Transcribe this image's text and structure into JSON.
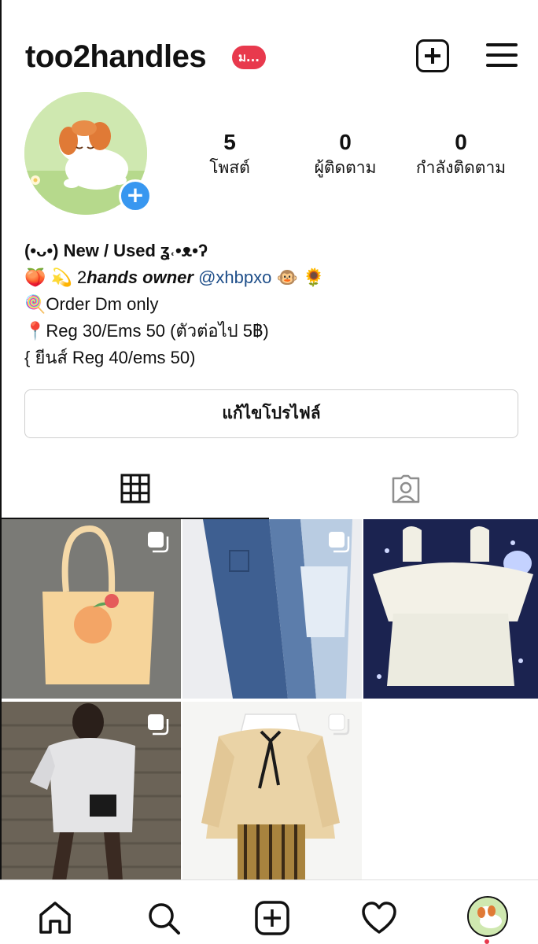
{
  "header": {
    "username": "too2handles",
    "badge": "ม...",
    "create_icon": "plus-square-icon",
    "menu_icon": "hamburger-menu-icon"
  },
  "profile": {
    "avatar_add_symbol": "+"
  },
  "stats": {
    "posts": {
      "count": "5",
      "label": "โพสต์"
    },
    "followers": {
      "count": "0",
      "label": "ผู้ติดตาม"
    },
    "following": {
      "count": "0",
      "label": "กำลังติดตาม"
    }
  },
  "bio": {
    "line1": "(•ᴗ•) New / Used ʓ˓•ᴥ•ʔ",
    "line2_emoji": "🍑 💫",
    "line2_text": "2",
    "line2_italic": "hands owner",
    "line2_mention": "@xhbpxo",
    "line2_end_emoji": "🐵 🌻",
    "line3_emoji": "🍭",
    "line3_text": "Order Dm only",
    "line4_emoji": "📍",
    "line4_text": "Reg 30/Ems 50 (ตัวต่อไป 5฿)",
    "line5_text": "{ ยีนส์ Reg 40/ems 50)"
  },
  "edit_profile_label": "แก้ไขโปรไฟล์",
  "tabs": [
    {
      "name": "grid",
      "icon": "grid-icon",
      "active": true
    },
    {
      "name": "tagged",
      "icon": "tagged-person-icon",
      "active": false
    }
  ],
  "posts": [
    {
      "subject": "peach tote bag",
      "multi": true
    },
    {
      "subject": "two-tone jeans",
      "multi": true
    },
    {
      "subject": "white ruffle top",
      "multi": false
    },
    {
      "subject": "oversized tee outfit",
      "multi": true
    },
    {
      "subject": "cream cardigan with bow",
      "multi": true
    }
  ],
  "bottom_nav": [
    {
      "name": "home",
      "icon": "home-icon"
    },
    {
      "name": "search",
      "icon": "search-icon"
    },
    {
      "name": "create",
      "icon": "plus-square-icon"
    },
    {
      "name": "activity",
      "icon": "heart-icon"
    },
    {
      "name": "profile",
      "icon": "avatar-icon"
    }
  ],
  "colors": {
    "accent_blue": "#3897f0",
    "badge_red": "#e8394d",
    "mention_blue": "#1f4f8a"
  }
}
